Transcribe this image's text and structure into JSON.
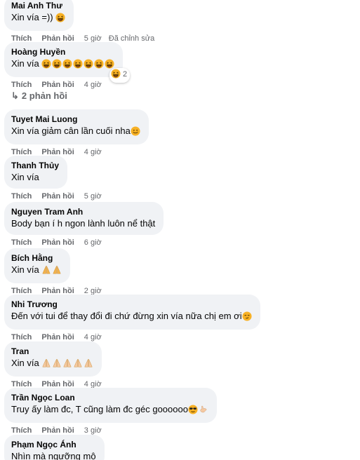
{
  "comments": [
    {
      "author": "Mai Anh Thư",
      "text": "Xin vía =))",
      "emojis": [
        "laugh"
      ],
      "like": "Thích",
      "reply": "Phản hồi",
      "time": "5 giờ",
      "edited": "Đã chỉnh sửa"
    },
    {
      "author": "Hoàng Huyền",
      "text": "Xin vía",
      "emojis": [
        "laugh",
        "laugh",
        "laugh",
        "laugh",
        "laugh",
        "laugh",
        "laugh"
      ],
      "like": "Thích",
      "reply": "Phản hồi",
      "time": "4 giờ",
      "reaction_count": "2"
    },
    {
      "author": "Tuyet Mai Luong",
      "text": "Xin vía giảm cân lần cuối nha",
      "emojis": [
        "smile"
      ],
      "like": "Thích",
      "reply": "Phản hồi",
      "time": "4 giờ"
    },
    {
      "author": "Thanh Thủy",
      "text": "Xin vía",
      "emojis": [],
      "like": "Thích",
      "reply": "Phản hồi",
      "time": "5 giờ"
    },
    {
      "author": "Nguyen Tram Anh",
      "text": "Body bạn í h ngon lành luôn nể thật",
      "emojis": [],
      "like": "Thích",
      "reply": "Phản hồi",
      "time": "6 giờ"
    },
    {
      "author": "Bích Hằng",
      "text": "Xin vía",
      "emojis": [
        "pray",
        "pray"
      ],
      "like": "Thích",
      "reply": "Phản hồi",
      "time": "2 giờ"
    },
    {
      "author": "Nhi Trương",
      "text": "Đến với tui để thay đổi đi chứ đừng xin vía nữa chị em ơi",
      "emojis": [
        "smirk"
      ],
      "like": "Thích",
      "reply": "Phản hồi",
      "time": "4 giờ"
    },
    {
      "author": "Tran",
      "text": "Xin vía",
      "emojis": [
        "pray-light",
        "pray-light",
        "pray-light",
        "pray-light",
        "pray-light"
      ],
      "like": "Thích",
      "reply": "Phản hồi",
      "time": "4 giờ"
    },
    {
      "author": "Trần Ngọc Loan",
      "text": "Truy ấy làm đc, T cũng làm đc géc goooooo",
      "emojis": [
        "sunglasses",
        "call-me"
      ],
      "like": "Thích",
      "reply": "Phản hồi",
      "time": "3 giờ"
    },
    {
      "author": "Phạm Ngọc Ánh",
      "text": "Nhìn mà ngưỡng mộ",
      "emojis": []
    }
  ],
  "replies_toggle": {
    "label": "2 phản hồi",
    "icon": "reply-arrow-icon"
  },
  "colors": {
    "bubble": "#f0f2f5",
    "meta": "#65676b",
    "text": "#050505",
    "emoji": "#f7b125"
  }
}
